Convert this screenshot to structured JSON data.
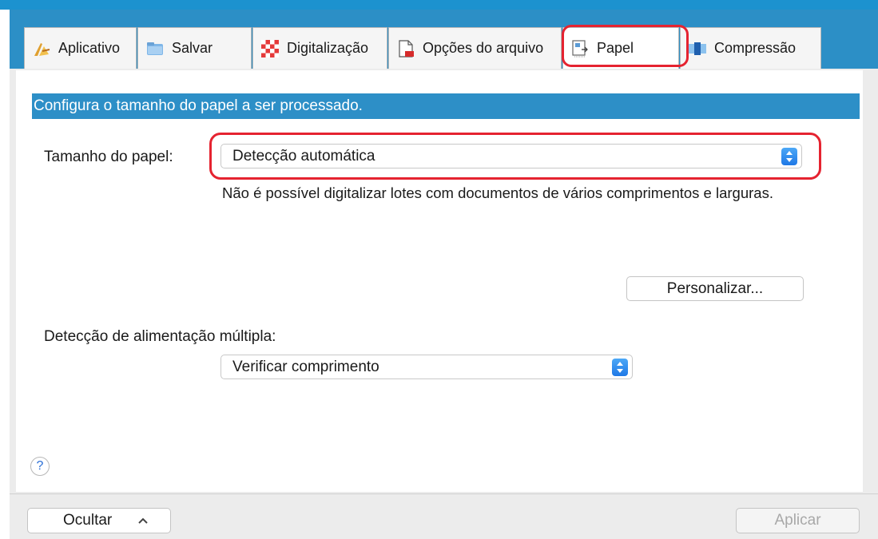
{
  "tabs": [
    {
      "label": "Aplicativo",
      "icon": "application-icon"
    },
    {
      "label": "Salvar",
      "icon": "folder-icon"
    },
    {
      "label": "Digitalização",
      "icon": "scan-icon"
    },
    {
      "label": "Opções do arquivo",
      "icon": "file-options-icon"
    },
    {
      "label": "Papel",
      "icon": "paper-icon",
      "selected": true
    },
    {
      "label": "Compressão",
      "icon": "compression-icon"
    }
  ],
  "banner": "Configura o tamanho do papel a ser processado.",
  "paper_size": {
    "label": "Tamanho do papel:",
    "value": "Detecção automática",
    "note": "Não é possível digitalizar lotes com documentos de vários comprimentos e larguras."
  },
  "customize_button": "Personalizar...",
  "multifeed": {
    "label": "Detecção de alimentação múltipla:",
    "value": "Verificar comprimento"
  },
  "help": "?",
  "footer": {
    "hide_button": "Ocultar",
    "apply_button": "Aplicar"
  },
  "colors": {
    "toolbar": "#2c8fc6",
    "banner": "#2d8fc7",
    "highlight": "#e52330",
    "stepper": "#1f78e6"
  }
}
